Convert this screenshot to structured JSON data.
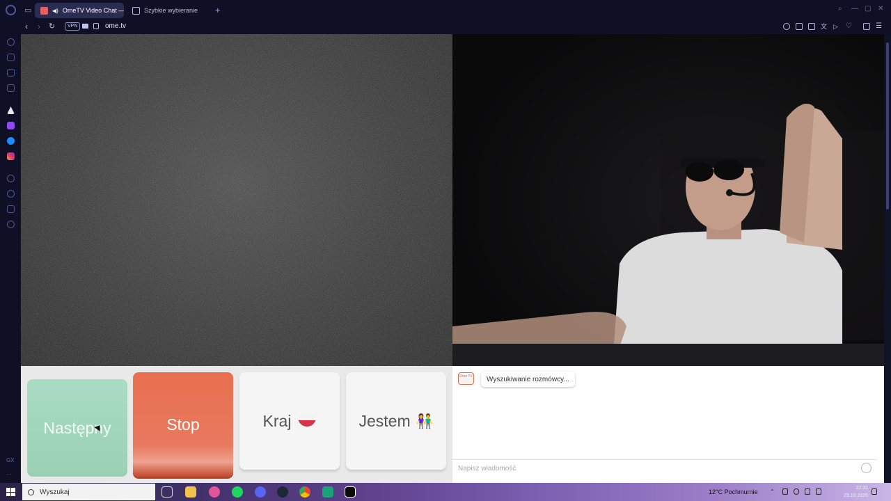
{
  "browser": {
    "tabs": [
      {
        "label": "OmeTV Video Chat —",
        "active": true
      },
      {
        "label": "Szybkie wybieranie",
        "active": false
      }
    ],
    "vpn_label": "VPN",
    "url": "ome.tv",
    "accent_color": "#2a2d52"
  },
  "sidebar": {
    "bottom_label": "GX"
  },
  "controls": {
    "next_label": "Następny",
    "stop_label": "Stop",
    "country_label": "Kraj",
    "country_flag": "poland-flag-icon",
    "gender_label": "Jestem",
    "gender_icon": "couple-emoji-icon",
    "stop_color": "#e96f4f",
    "next_color": "#a9dcc2"
  },
  "chat": {
    "logo_text": "Ome TV",
    "status_message": "Wyszukiwanie rozmówcy...",
    "input_placeholder": "Napisz wiadomość"
  },
  "taskbar": {
    "search_placeholder": "Wyszukaj",
    "weather": "12°C  Pochmurnie",
    "time": "22:31",
    "date": "23.10.2025"
  }
}
